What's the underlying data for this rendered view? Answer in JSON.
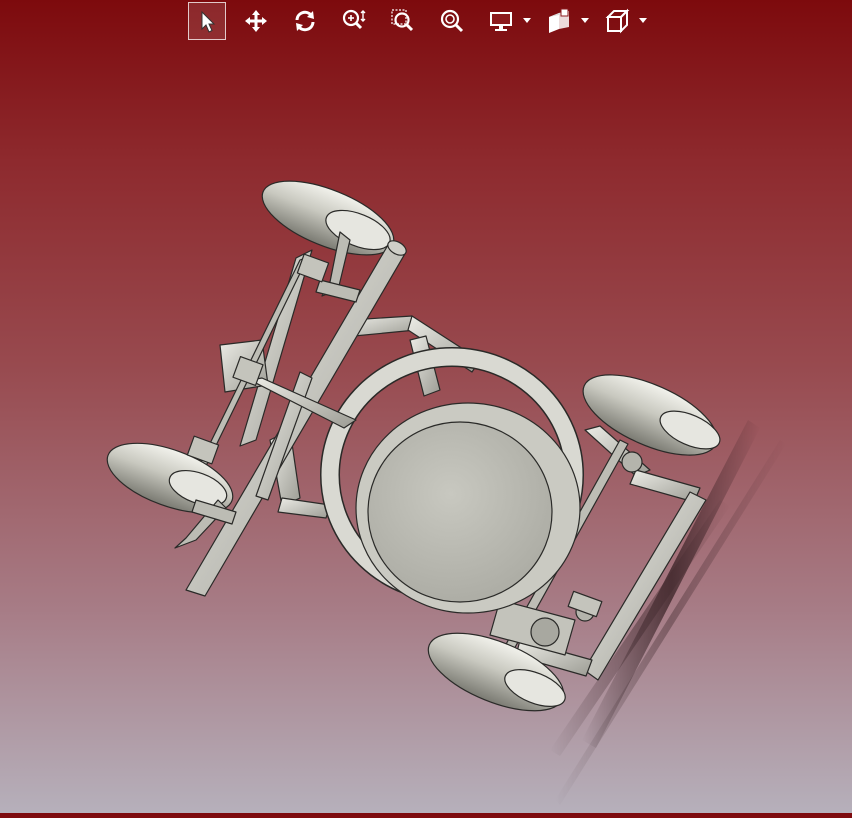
{
  "toolbar": {
    "tools": [
      {
        "icon": "select-arrow-icon",
        "active": true
      },
      {
        "icon": "pan-move-icon",
        "active": false
      },
      {
        "icon": "rotate-icon",
        "active": false
      },
      {
        "icon": "zoom-in-out-icon",
        "active": false
      },
      {
        "icon": "zoom-window-icon",
        "active": false
      },
      {
        "icon": "zoom-fit-icon",
        "active": false
      }
    ],
    "dropdowns": [
      {
        "icon": "display-monitor-icon"
      },
      {
        "icon": "section-view-icon"
      },
      {
        "icon": "view-cube-icon"
      }
    ]
  },
  "viewport": {
    "model": "go-kart-chassis-assembly",
    "background_top": "#7d0a0d",
    "background_bottom": "#b6b0bb",
    "part_color": "#d4d4cc"
  }
}
